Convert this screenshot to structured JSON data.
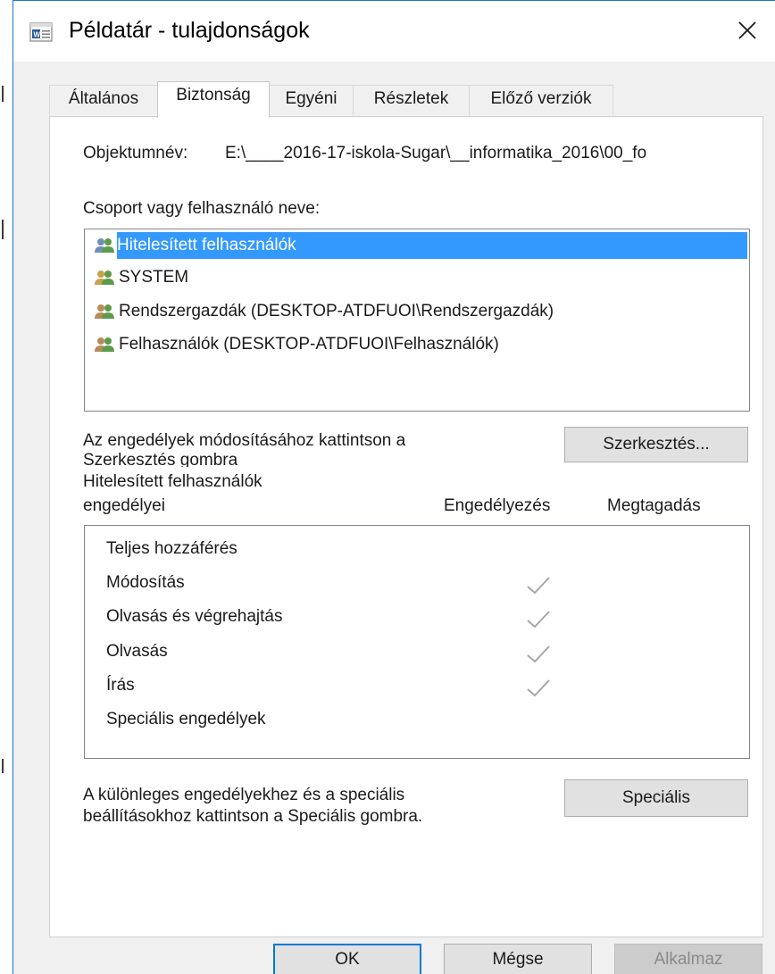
{
  "window": {
    "title": "Példatár - tulajdonságok",
    "icon": "word-document-icon",
    "close_glyph": "✕"
  },
  "tabs": [
    {
      "label": "Általános",
      "active": false
    },
    {
      "label": "Biztonság",
      "active": true
    },
    {
      "label": "Egyéni",
      "active": false
    },
    {
      "label": "Részletek",
      "active": false
    },
    {
      "label": "Előző verziók",
      "active": false
    }
  ],
  "security": {
    "object_name_label": "Objektumnév:",
    "object_name_value": "E:\\____2016-17-iskola-Sugar\\__informatika_2016\\00_fo",
    "group_label": "Csoport vagy felhasználó neve:",
    "groups": [
      {
        "name": "Hitelesített felhasználók",
        "selected": true,
        "icon": "users-group-icon"
      },
      {
        "name": "SYSTEM",
        "selected": false,
        "icon": "users-group-icon"
      },
      {
        "name": "Rendszergazdák (DESKTOP-ATDFUOI\\Rendszergazdák)",
        "selected": false,
        "icon": "users-group-icon"
      },
      {
        "name": "Felhasználók (DESKTOP-ATDFUOI\\Felhasználók)",
        "selected": false,
        "icon": "users-group-icon"
      }
    ],
    "edit_hint_line1": "Az engedélyek módosításához kattintson a",
    "edit_hint_line2": "Szerkesztés gombra",
    "edit_button": "Szerkesztés...",
    "permissions_for_line1": "Hitelesített felhasználók",
    "permissions_for_line2": "engedélyei",
    "col_allow": "Engedélyezés",
    "col_deny": "Megtagadás",
    "permissions": [
      {
        "name": "Teljes hozzáférés",
        "allow": false,
        "deny": false
      },
      {
        "name": "Módosítás",
        "allow": true,
        "deny": false
      },
      {
        "name": "Olvasás és végrehajtás",
        "allow": true,
        "deny": false
      },
      {
        "name": "Olvasás",
        "allow": true,
        "deny": false
      },
      {
        "name": "Írás",
        "allow": true,
        "deny": false
      },
      {
        "name": "Speciális engedélyek",
        "allow": false,
        "deny": false
      }
    ],
    "special_hint_line1": "A különleges engedélyekhez és a speciális",
    "special_hint_line2": "beállításokhoz kattintson a Speciális gombra.",
    "special_button": "Speciális"
  },
  "footer": {
    "ok": "OK",
    "cancel": "Mégse",
    "apply": "Alkalmaz"
  },
  "colors": {
    "selection": "#3399ff",
    "window_border": "#1979ca",
    "default_button_border": "#0078d7"
  }
}
